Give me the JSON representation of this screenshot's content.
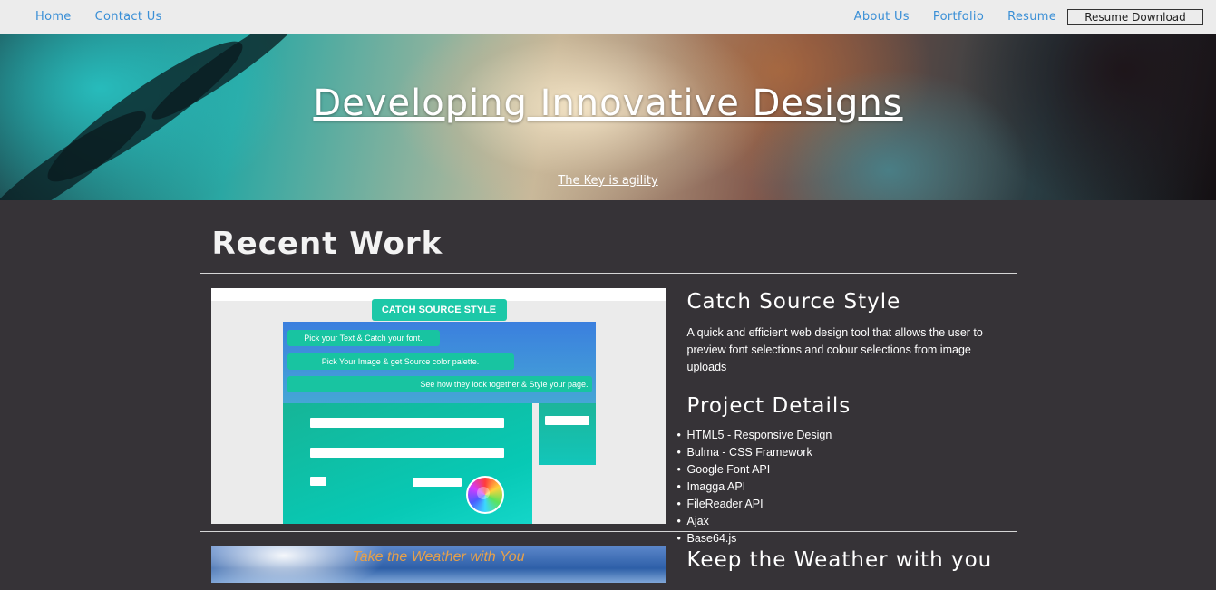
{
  "nav": {
    "left": [
      "Home",
      "Contact Us"
    ],
    "right": [
      "About Us",
      "Portfolio",
      "Resume"
    ],
    "download_label": "Resume Download"
  },
  "hero": {
    "title": "Developing Innovative Designs",
    "subtitle": "The Key is agility"
  },
  "section": {
    "title": "Recent Work"
  },
  "projects": [
    {
      "title": "Catch Source Style",
      "description": "A quick and efficient web design tool that allows the user to preview font selections and colour selections from image uploads",
      "details_title": "Project Details",
      "details": [
        "HTML5 - Responsive Design",
        "Bulma - CSS Framework",
        "Google Font API",
        "Imagga API",
        "FileReader API",
        "Ajax",
        "Base64.js"
      ],
      "screenshot": {
        "header": "CATCH SOURCE STYLE",
        "steps": [
          "Pick your Text & Catch your font.",
          "Pick Your Image & get Source color palette.",
          "See how they look together & Style your page."
        ]
      }
    },
    {
      "title": "Keep the Weather with you",
      "screenshot": {
        "header": "Take the Weather with You"
      }
    }
  ],
  "colors": {
    "nav_link": "#3a8fd6",
    "page_bg": "#363337",
    "accent_green": "#1dc8a8"
  }
}
